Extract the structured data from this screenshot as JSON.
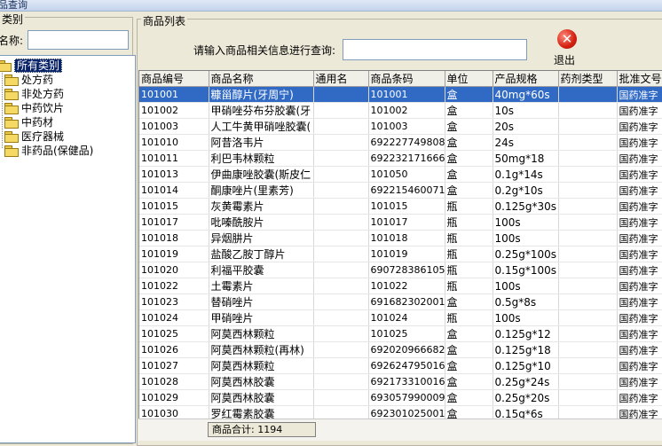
{
  "window": {
    "title": "品查询"
  },
  "category_panel": {
    "title": "类别",
    "name_label": "名称:",
    "name_value": "",
    "tree": [
      {
        "label": "所有类别",
        "selected": true
      },
      {
        "label": "处方药"
      },
      {
        "label": "非处方药"
      },
      {
        "label": "中药饮片"
      },
      {
        "label": "中药材"
      },
      {
        "label": "医疗器械"
      },
      {
        "label": "非药品(保健品)"
      }
    ]
  },
  "product_panel": {
    "title": "商品列表",
    "query_label": "请输入商品相关信息进行查询:",
    "query_value": "",
    "exit_label": "退出",
    "exit_icon": "x-circle-icon",
    "columns": [
      "商品编号",
      "商品名称",
      "通用名",
      "商品条码",
      "单位",
      "产品规格",
      "药剂类型",
      "批准文号"
    ],
    "rows": [
      [
        "101001",
        "糠甾醇片(牙周宁)",
        "",
        "101001",
        "盒",
        "40mg*60s",
        "",
        "国药准字"
      ],
      [
        "101002",
        "甲硝唑芬布芬胶囊(牙",
        "",
        "101002",
        "盒",
        "10s",
        "",
        "国药准字"
      ],
      [
        "101003",
        "人工牛黄甲硝唑胶囊(",
        "",
        "101003",
        "盒",
        "20s",
        "",
        "国药准字"
      ],
      [
        "101010",
        "阿昔洛韦片",
        "",
        "6922277498080",
        "盒",
        "24s",
        "",
        "国药准字"
      ],
      [
        "101011",
        "利巴韦林颗粒",
        "",
        "6922321716665",
        "盒",
        "50mg*18",
        "",
        "国药准字"
      ],
      [
        "101013",
        "伊曲康唑胶囊(斯皮仁",
        "",
        "101050",
        "盒",
        "0.1g*14s",
        "",
        "国药准字"
      ],
      [
        "101014",
        "酮康唑片(里素芳)",
        "",
        "6922154600711",
        "盒",
        "0.2g*10s",
        "",
        "国药准字"
      ],
      [
        "101015",
        "灰黄霉素片",
        "",
        "101015",
        "瓶",
        "0.125g*30s",
        "",
        "国药准字"
      ],
      [
        "101017",
        "吡嗪酰胺片",
        "",
        "101017",
        "瓶",
        "100s",
        "",
        "国药准字"
      ],
      [
        "101018",
        "异烟肼片",
        "",
        "101018",
        "瓶",
        "100s",
        "",
        "国药准字"
      ],
      [
        "101019",
        "盐酸乙胺丁醇片",
        "",
        "101019",
        "瓶",
        "0.25g*100s",
        "",
        "国药准字"
      ],
      [
        "101020",
        "利福平胶囊",
        "",
        "6907283861059",
        "瓶",
        "0.15g*100s",
        "",
        "国药准字"
      ],
      [
        "101022",
        "土霉素片",
        "",
        "101022",
        "瓶",
        "100s",
        "",
        "国药准字"
      ],
      [
        "101023",
        "替硝唑片",
        "",
        "6916823020016",
        "盒",
        "0.5g*8s",
        "",
        "国药准字"
      ],
      [
        "101024",
        "甲硝唑片",
        "",
        "101024",
        "瓶",
        "100s",
        "",
        "国药准字"
      ],
      [
        "101025",
        "阿莫西林颗粒",
        "",
        "101025",
        "盒",
        "0.125g*12",
        "",
        "国药准字"
      ],
      [
        "101026",
        "阿莫西林颗粒(再林)",
        "",
        "6920209666828",
        "盒",
        "0.125g*18",
        "",
        "国药准字"
      ],
      [
        "101027",
        "阿莫西林颗粒",
        "",
        "6926247950165",
        "盒",
        "0.125g*10",
        "",
        "国药准字"
      ],
      [
        "101028",
        "阿莫西林胶囊",
        "",
        "6921733100161",
        "盒",
        "0.25g*24s",
        "",
        "国药准字"
      ],
      [
        "101029",
        "阿莫西林胶囊",
        "",
        "6930579900095",
        "盒",
        "0.25g*20s",
        "",
        "国药准字"
      ],
      [
        "101030",
        "罗红霉素胶囊",
        "",
        "6923010250019",
        "盒",
        "0.15g*6s",
        "",
        "国药准字"
      ],
      [
        "101031",
        "罗红霉素分散片",
        "",
        "6900572060263",
        "盒",
        "0.15*12s",
        "",
        "国药准字"
      ]
    ],
    "total_label": "商品合计: 1194"
  }
}
